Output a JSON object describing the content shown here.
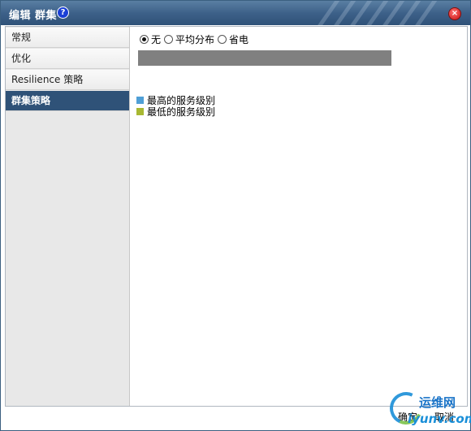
{
  "window": {
    "title": "编辑 群集"
  },
  "sidebar": {
    "items": [
      {
        "label": "常规",
        "active": false
      },
      {
        "label": "优化",
        "active": false
      },
      {
        "label": "Resilience 策略",
        "active": false
      },
      {
        "label": "群集策略",
        "active": true
      }
    ]
  },
  "policy": {
    "options": [
      {
        "label": "无",
        "checked": true
      },
      {
        "label": "平均分布",
        "checked": false
      },
      {
        "label": "省电",
        "checked": false
      }
    ],
    "bar_color": "#808080"
  },
  "legend": [
    {
      "label": "最高的服务级别",
      "color": "#4f9fd6"
    },
    {
      "label": "最低的服务级别",
      "color": "#a8b832"
    }
  ],
  "footer": {
    "ok_label": "确定",
    "cancel_label": "取消"
  },
  "watermark": {
    "line1": "运维网",
    "line2": "iyunv.com"
  },
  "colors": {
    "titlebar": "#3d6189",
    "active_nav": "#2f5278"
  }
}
